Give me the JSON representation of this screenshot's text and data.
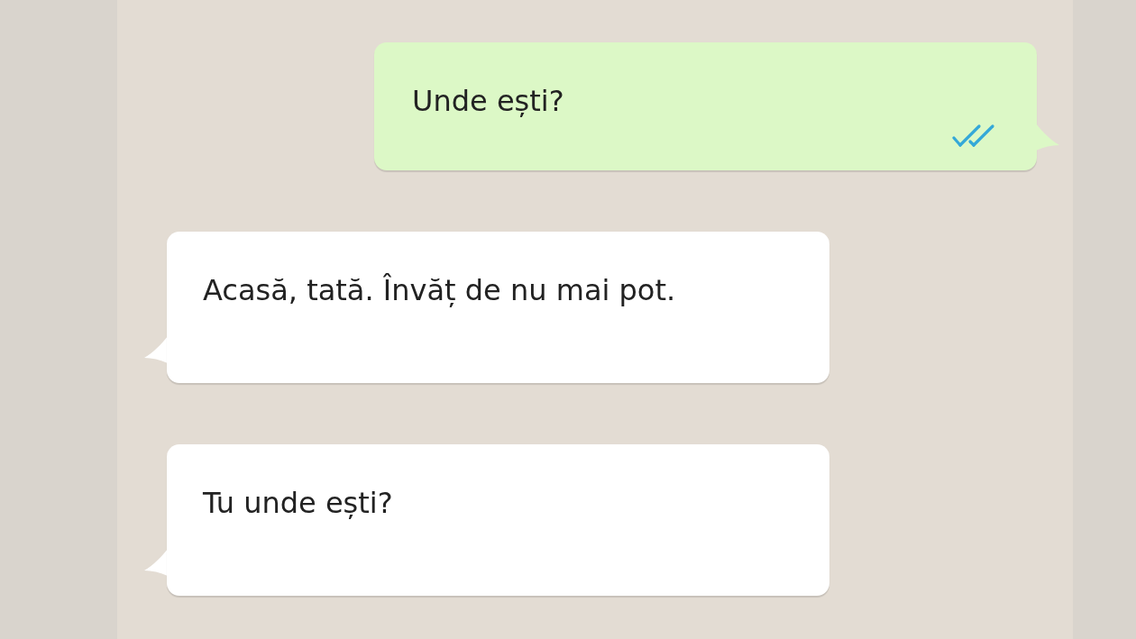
{
  "messages": [
    {
      "kind": "sent",
      "text": "Unde ești?",
      "read": true
    },
    {
      "kind": "received",
      "text": "Acasă, tată. Învăț de nu mai pot."
    },
    {
      "kind": "received",
      "text": "Tu unde ești?"
    }
  ]
}
